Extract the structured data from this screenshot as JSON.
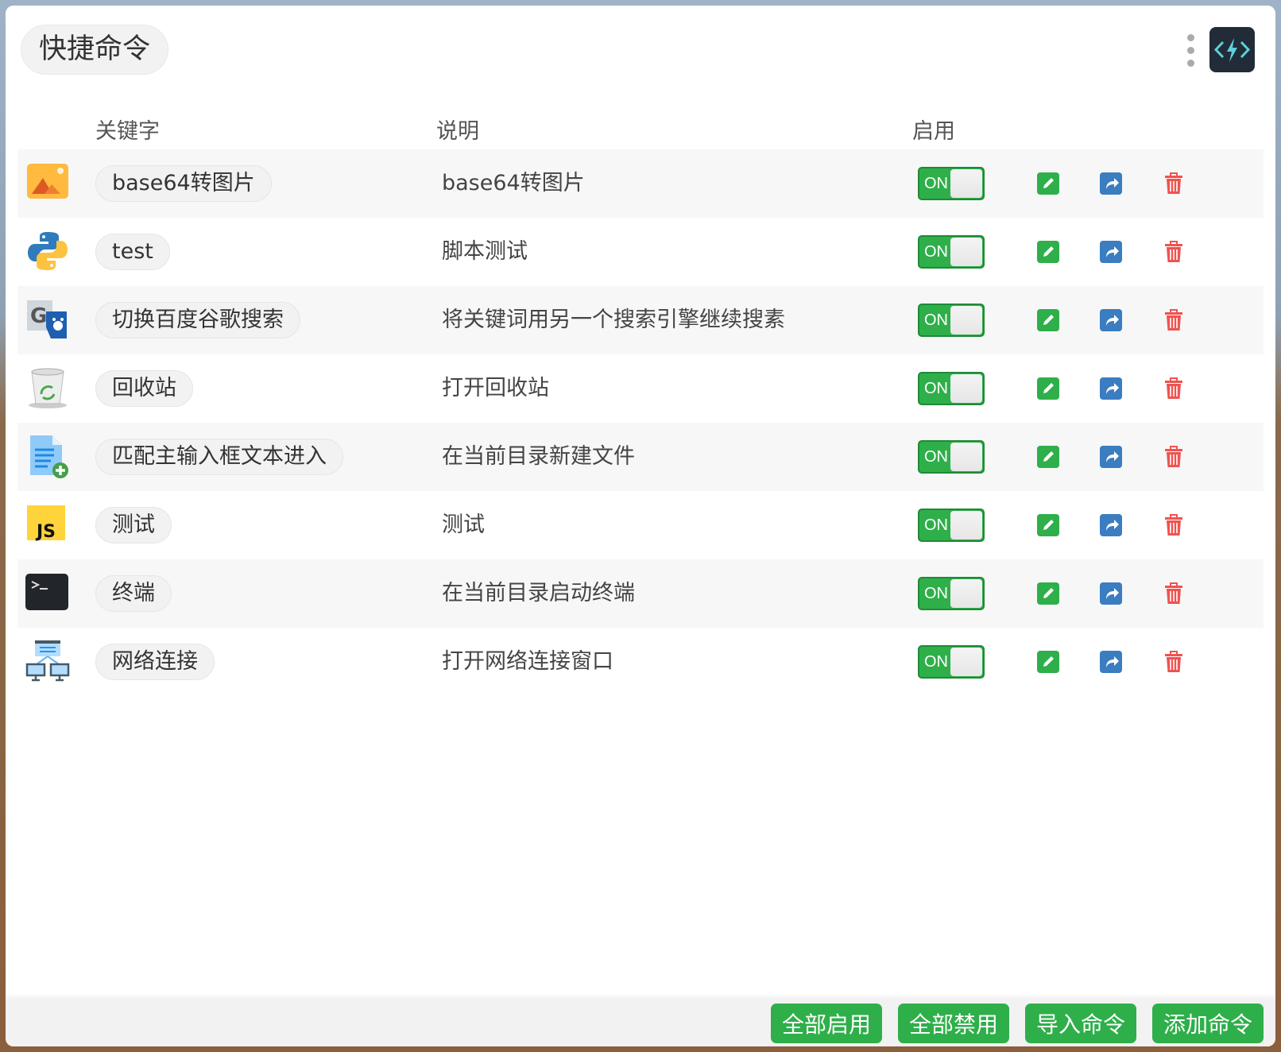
{
  "window": {
    "title": "快捷命令"
  },
  "header": {
    "keyword": "关键字",
    "description": "说明",
    "enabled": "启用"
  },
  "rows": [
    {
      "icon": "image-icon",
      "keyword": "base64转图片",
      "description": "base64转图片",
      "enabled": "ON"
    },
    {
      "icon": "python-icon",
      "keyword": "test",
      "description": "脚本测试",
      "enabled": "ON"
    },
    {
      "icon": "google-baidu-icon",
      "keyword": "切换百度谷歌搜索",
      "description": "将关键词用另一个搜索引擎继续搜素",
      "enabled": "ON"
    },
    {
      "icon": "recycle-bin-icon",
      "keyword": "回收站",
      "description": "打开回收站",
      "enabled": "ON"
    },
    {
      "icon": "new-file-icon",
      "keyword": "匹配主输入框文本进入",
      "description": "在当前目录新建文件",
      "enabled": "ON"
    },
    {
      "icon": "javascript-icon",
      "keyword": "测试",
      "description": "测试",
      "enabled": "ON"
    },
    {
      "icon": "terminal-icon",
      "keyword": "终端",
      "description": "在当前目录启动终端",
      "enabled": "ON"
    },
    {
      "icon": "network-icon",
      "keyword": "网络连接",
      "description": "打开网络连接窗口",
      "enabled": "ON"
    }
  ],
  "footer": {
    "enable_all": "全部启用",
    "disable_all": "全部禁用",
    "import": "导入命令",
    "add": "添加命令"
  },
  "colors": {
    "green": "#2eaf4a",
    "blue": "#3a7dc0",
    "red": "#ef5350"
  }
}
